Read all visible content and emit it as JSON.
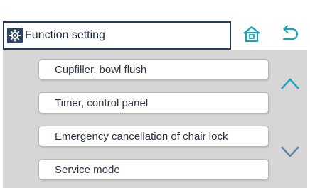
{
  "header": {
    "title": "Function setting",
    "icons": {
      "settings": "gear-icon",
      "home": "home-icon",
      "back": "back-arrow-icon"
    }
  },
  "menu": {
    "items": [
      {
        "label": "Cupfiller, bowl flush"
      },
      {
        "label": "Timer, control panel"
      },
      {
        "label": "Emergency cancellation of chair lock"
      },
      {
        "label": "Service mode"
      }
    ]
  },
  "scroll": {
    "up_icon": "chevron-up-icon",
    "down_icon": "chevron-down-icon"
  },
  "colors": {
    "accent": "#1aa3b8",
    "header_border": "#263b57",
    "content_bg": "#d6d6d6",
    "button_bg": "#ffffff",
    "scroll_arrow": "#5d7fa0"
  }
}
